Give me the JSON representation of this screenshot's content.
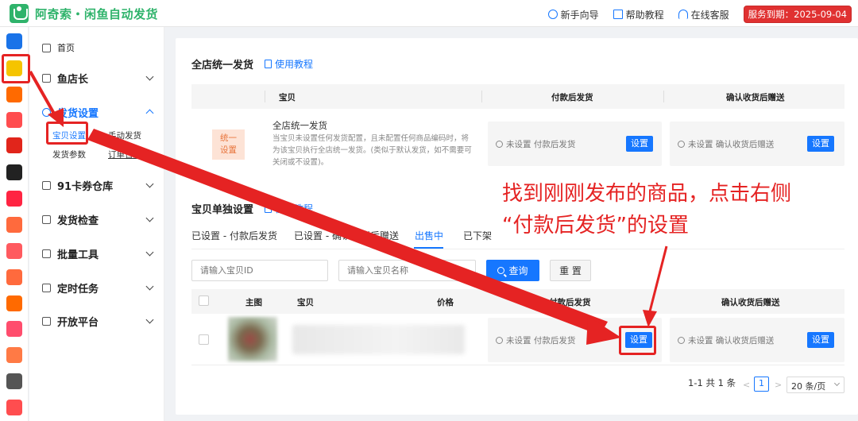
{
  "header": {
    "brand_title": "阿奇索・闲鱼自动发货",
    "links": [
      {
        "label": "新手向导",
        "icon": "help-circle-icon"
      },
      {
        "label": "帮助教程",
        "icon": "document-icon"
      },
      {
        "label": "在线客服",
        "icon": "headset-icon"
      }
    ],
    "expire_badge": "服务到期：2025-09-04"
  },
  "rail": {
    "items": [
      {
        "icon": "apps-grid-icon",
        "color": "#1a73e8"
      },
      {
        "icon": "xianyu-app-icon",
        "color": "#f5c400"
      },
      {
        "icon": "taobao-app-icon",
        "color": "#ff6a00"
      },
      {
        "icon": "tmall-app-icon",
        "color": "#ff4d4f"
      },
      {
        "icon": "jd-app-icon",
        "color": "#e1251b"
      },
      {
        "icon": "douyin-app-icon",
        "color": "#222222"
      },
      {
        "icon": "xiaohongshu-app-icon",
        "color": "#ff2442"
      },
      {
        "icon": "kuaishou-app-icon",
        "color": "#ff6a3d"
      },
      {
        "icon": "thumb-app-icon",
        "color": "#ff5a5f"
      },
      {
        "icon": "store-app-icon",
        "color": "#ff6a3d"
      },
      {
        "icon": "shop-app-icon",
        "color": "#ff6a00"
      },
      {
        "icon": "link-app-icon",
        "color": "#ff4d6d"
      },
      {
        "icon": "face-app-icon",
        "color": "#ff7a45"
      },
      {
        "icon": "cashier-app-icon",
        "color": "#555555"
      },
      {
        "icon": "gift-app-icon",
        "color": "#ff4d4f"
      }
    ]
  },
  "sidebar": {
    "home": "首页",
    "items": [
      {
        "label": "鱼店长"
      },
      {
        "label": "发货设置"
      },
      {
        "label": "91卡券仓库"
      },
      {
        "label": "发货检查"
      },
      {
        "label": "批量工具"
      },
      {
        "label": "定时任务"
      },
      {
        "label": "开放平台"
      }
    ],
    "sub": {
      "baby_settings": "宝贝设置",
      "manual_ship": "手动发货",
      "ship_params": "发货参数",
      "order_log": "订单日志"
    }
  },
  "global_section": {
    "title": "全店统一发货",
    "help": "使用教程",
    "columns": [
      "宝贝",
      "付款后发货",
      "确认收货后赠送"
    ],
    "badge": "统一\n设置",
    "item_title": "全店统一发货",
    "item_desc": "当宝贝未设置任何发货配置，且未配置任何商品编码时，将为该宝贝执行全店统一发货。(类似于默认发货，如不需要可关闭或不设置)。",
    "pay_status": "未设置 付款后发货",
    "confirm_status": "未设置 确认收货后赠送",
    "set_label": "设置"
  },
  "item_section": {
    "title": "宝贝单独设置",
    "help": "使用教程",
    "tabs": [
      "已设置 - 付款后发货",
      "已设置 - 确认收货后赠送",
      "出售中",
      "已下架"
    ],
    "active_tab": "出售中",
    "search": {
      "id_placeholder": "请输入宝贝ID",
      "name_placeholder": "请输入宝贝名称",
      "query_label": "查询",
      "reset_label": "重 置"
    },
    "columns": [
      "主图",
      "宝贝",
      "价格",
      "付款后发货",
      "确认收货后赠送"
    ],
    "row": {
      "pay_status": "未设置 付款后发货",
      "confirm_status": "未设置 确认收货后赠送",
      "set_label": "设置"
    }
  },
  "pagination": {
    "summary": "1-1 共 1 条",
    "current_page": "1",
    "prev": "<",
    "next": ">",
    "page_size": "20 条/页"
  },
  "annotation": {
    "line1": "找到刚刚发布的商品，点击右侧",
    "line2": "“付款后发货”的设置",
    "color": "#e52323"
  }
}
